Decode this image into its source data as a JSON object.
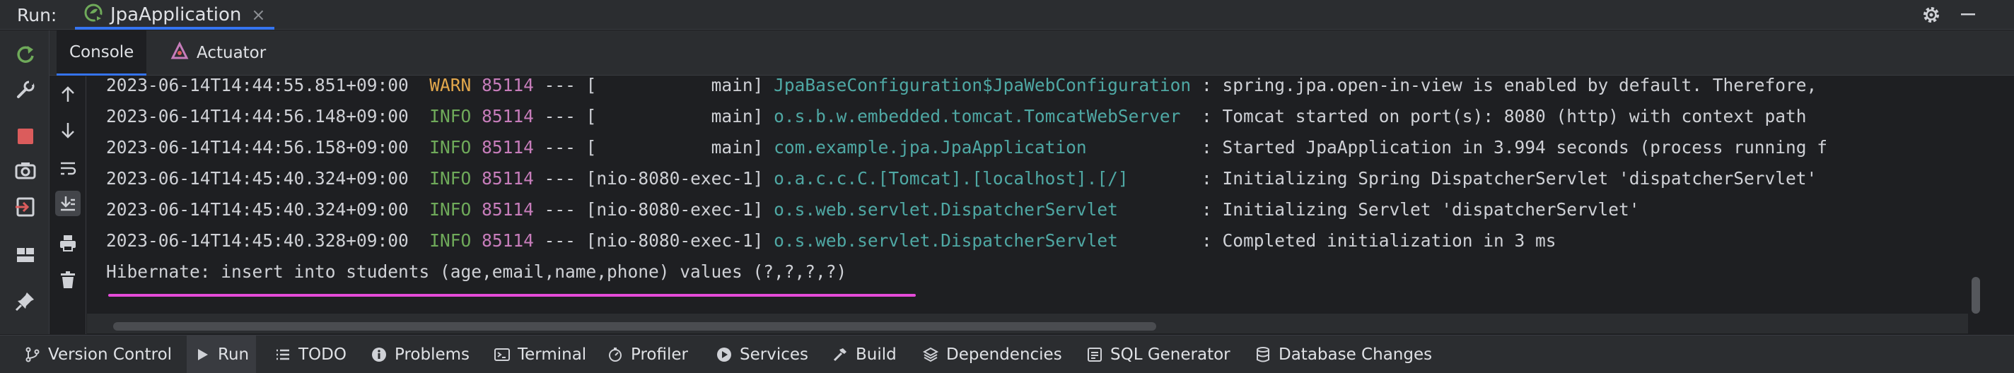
{
  "run_bar": {
    "label": "Run:",
    "tab_name": "JpaApplication",
    "tab_close": "×",
    "icons": [
      "spring-boot-icon",
      "gear-icon",
      "minimize-icon"
    ]
  },
  "subtabs": {
    "console": "Console",
    "actuator": "Actuator"
  },
  "left_toolbar": [
    "rerun-icon",
    "wrench-icon",
    "stop-icon",
    "camera-icon",
    "exit-icon",
    "layout-icon",
    "pin-icon"
  ],
  "inner_toolbar": [
    "up-arrow-icon",
    "down-arrow-icon",
    "soft-wrap-icon",
    "scroll-to-end-icon",
    "print-icon",
    "trash-icon"
  ],
  "log_lines": [
    {
      "ts": "2023-06-14T14:44:55.851+09:00",
      "level": "WARN",
      "pid": "85114",
      "sep": "---",
      "thread": "[           main]",
      "logger": "JpaBaseConfiguration$JpaWebConfiguration",
      "msg": ": spring.jpa.open-in-view is enabled by default. Therefore,"
    },
    {
      "ts": "2023-06-14T14:44:56.148+09:00",
      "level": "INFO",
      "pid": "85114",
      "sep": "---",
      "thread": "[           main]",
      "logger": "o.s.b.w.embedded.tomcat.TomcatWebServer ",
      "msg": ": Tomcat started on port(s): 8080 (http) with context path"
    },
    {
      "ts": "2023-06-14T14:44:56.158+09:00",
      "level": "INFO",
      "pid": "85114",
      "sep": "---",
      "thread": "[           main]",
      "logger": "com.example.jpa.JpaApplication          ",
      "msg": ": Started JpaApplication in 3.994 seconds (process running f"
    },
    {
      "ts": "2023-06-14T14:45:40.324+09:00",
      "level": "INFO",
      "pid": "85114",
      "sep": "---",
      "thread": "[nio-8080-exec-1]",
      "logger": "o.a.c.c.C.[Tomcat].[localhost].[/]      ",
      "msg": ": Initializing Spring DispatcherServlet 'dispatcherServlet'"
    },
    {
      "ts": "2023-06-14T14:45:40.324+09:00",
      "level": "INFO",
      "pid": "85114",
      "sep": "---",
      "thread": "[nio-8080-exec-1]",
      "logger": "o.s.web.servlet.DispatcherServlet       ",
      "msg": ": Initializing Servlet 'dispatcherServlet'"
    },
    {
      "ts": "2023-06-14T14:45:40.328+09:00",
      "level": "INFO",
      "pid": "85114",
      "sep": "---",
      "thread": "[nio-8080-exec-1]",
      "logger": "o.s.web.servlet.DispatcherServlet       ",
      "msg": ": Completed initialization in 3 ms"
    }
  ],
  "hibernate_line": "Hibernate: insert into students (age,email,name,phone) values (?,?,?,?)",
  "bottom_bar": [
    {
      "label": "Version Control",
      "icon": "branch-icon"
    },
    {
      "label": "Run",
      "icon": "play-icon"
    },
    {
      "label": "TODO",
      "icon": "list-icon"
    },
    {
      "label": "Problems",
      "icon": "info-icon"
    },
    {
      "label": "Terminal",
      "icon": "terminal-icon"
    },
    {
      "label": "Profiler",
      "icon": "profiler-icon"
    },
    {
      "label": "Services",
      "icon": "services-icon"
    },
    {
      "label": "Build",
      "icon": "hammer-icon"
    },
    {
      "label": "Dependencies",
      "icon": "dependencies-icon"
    },
    {
      "label": "SQL Generator",
      "icon": "sql-icon"
    },
    {
      "label": "Database Changes",
      "icon": "database-icon"
    }
  ],
  "colors": {
    "accent": "#3574f0",
    "warn": "#e2a74c",
    "info": "#6faa5a",
    "pid": "#c77dbb",
    "logger": "#4fa8a4",
    "highlight_underline": "#e44bd8",
    "stop_red": "#db5c5c"
  }
}
